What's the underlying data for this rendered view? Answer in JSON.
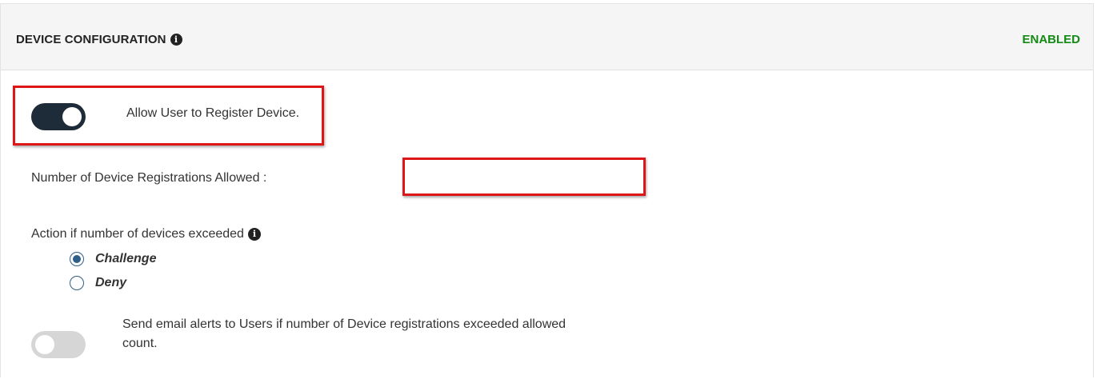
{
  "header": {
    "title": "DEVICE CONFIGURATION",
    "info_glyph": "i",
    "status": "ENABLED",
    "status_color": "#138a13"
  },
  "register_device": {
    "toggle_on": true,
    "label": "Allow User to Register Device."
  },
  "registrations": {
    "label": "Number of Device Registrations Allowed :",
    "value": ""
  },
  "action": {
    "label": "Action if number of devices exceeded",
    "info_glyph": "i",
    "options": [
      {
        "label": "Challenge",
        "selected": true
      },
      {
        "label": "Deny",
        "selected": false
      }
    ]
  },
  "email_alerts": {
    "toggle_on": false,
    "label_line1": "Send email alerts to Users if number of Device registrations exceeded allowed",
    "label_line2": "count."
  },
  "colors": {
    "toggle_on": "#1e2b38",
    "toggle_off": "#d6d6d6",
    "highlight": "#dd1717",
    "radio": "#2d5f8a"
  }
}
